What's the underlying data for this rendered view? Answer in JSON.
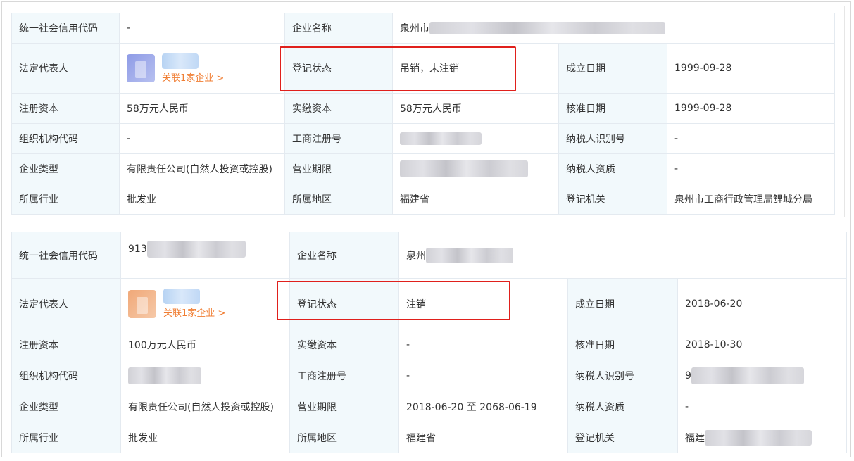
{
  "labels": {
    "credit_code": "统一社会信用代码",
    "company_name": "企业名称",
    "legal_rep": "法定代表人",
    "reg_status": "登记状态",
    "founded": "成立日期",
    "reg_capital": "注册资本",
    "paid_capital": "实缴资本",
    "approval_date": "核准日期",
    "org_code": "组织机构代码",
    "biz_reg_no": "工商注册号",
    "taxpayer_id": "纳税人识别号",
    "company_type": "企业类型",
    "biz_term": "营业期限",
    "taxpayer_qual": "纳税人资质",
    "industry": "所属行业",
    "region": "所属地区",
    "reg_authority": "登记机关"
  },
  "company1": {
    "credit_code": "-",
    "company_name_prefix": "泉州市",
    "related_link": "关联1家企业 >",
    "reg_status": "吊销，未注销",
    "founded": "1999-09-28",
    "reg_capital": "58万元人民币",
    "paid_capital": "58万元人民币",
    "approval_date": "1999-09-28",
    "org_code": "-",
    "taxpayer_id": "-",
    "company_type": "有限责任公司(自然人投资或控股)",
    "taxpayer_qual": "-",
    "industry": "批发业",
    "region": "福建省",
    "reg_authority": "泉州市工商行政管理局鲤城分局"
  },
  "company2": {
    "credit_code_prefix": "913",
    "company_name_prefix": "泉州",
    "related_link": "关联1家企业 >",
    "reg_status": "注销",
    "founded": "2018-06-20",
    "reg_capital": "100万元人民币",
    "paid_capital": "-",
    "approval_date": "2018-10-30",
    "biz_reg_no": "-",
    "taxpayer_id_prefix": "9",
    "company_type": "有限责任公司(自然人投资或控股)",
    "biz_term": "2018-06-20 至 2068-06-19",
    "taxpayer_qual": "-",
    "industry": "批发业",
    "region": "福建省",
    "reg_authority_prefix": "福建"
  },
  "colors": {
    "label_bg": "#f2f9fc",
    "border": "#e4eaf0",
    "link": "#f07d32",
    "highlight": "#e0201c"
  }
}
